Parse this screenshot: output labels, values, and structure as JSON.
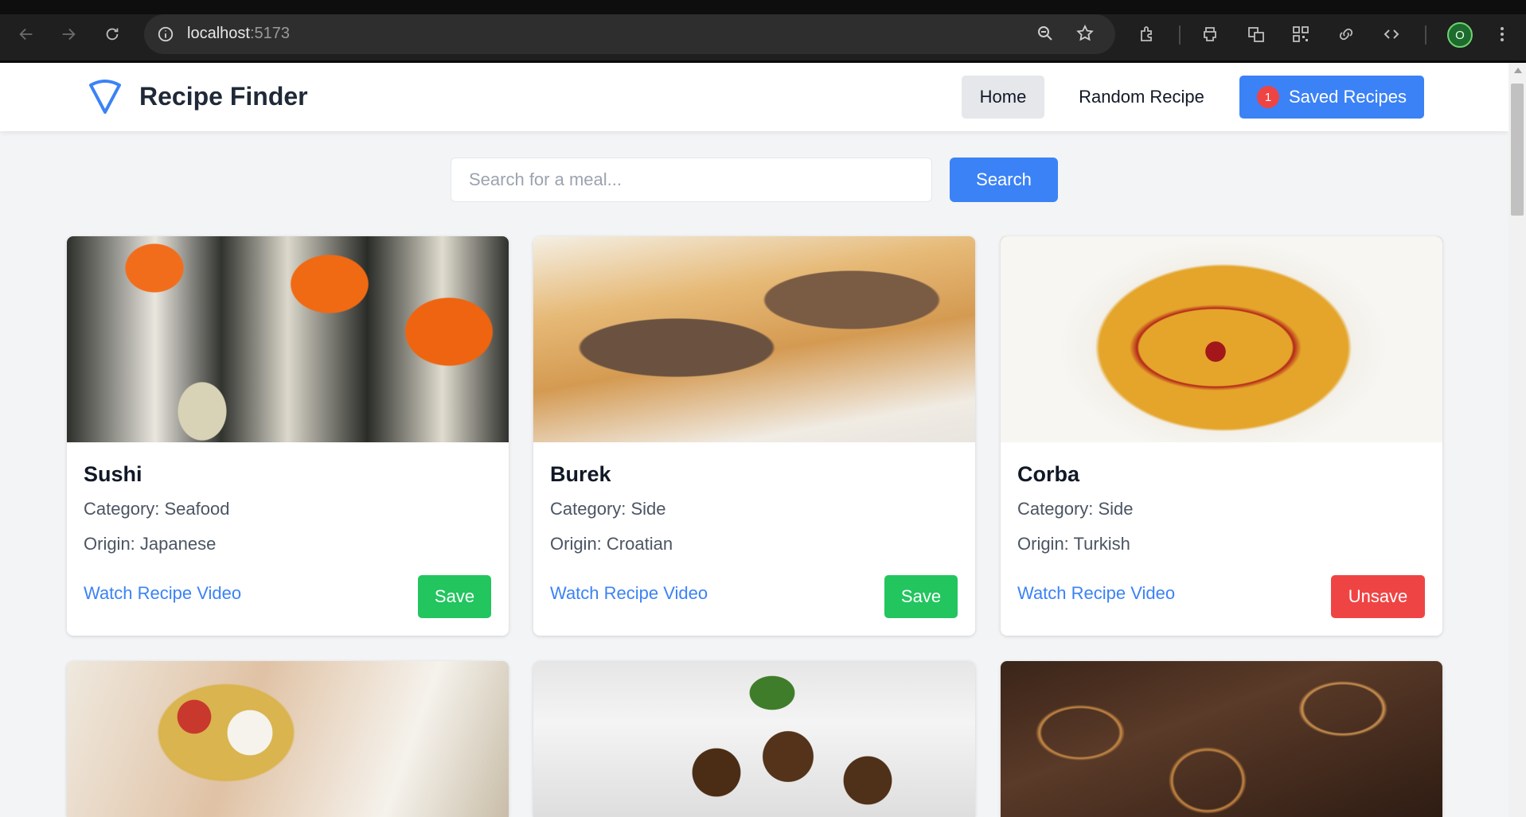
{
  "browser": {
    "url_host": "localhost",
    "url_port": ":5173",
    "profile_initial": "O"
  },
  "header": {
    "brand": "Recipe Finder",
    "nav": {
      "home": "Home",
      "random": "Random Recipe",
      "saved": "Saved Recipes",
      "saved_count": "1"
    }
  },
  "search": {
    "placeholder": "Search for a meal...",
    "button": "Search"
  },
  "recipes": [
    {
      "name": "Sushi",
      "category": "Category: Seafood",
      "origin": "Origin: Japanese",
      "video": "Watch Recipe Video",
      "action": "Save"
    },
    {
      "name": "Burek",
      "category": "Category: Side",
      "origin": "Origin: Croatian",
      "video": "Watch Recipe Video",
      "action": "Save"
    },
    {
      "name": "Corba",
      "category": "Category: Side",
      "origin": "Origin: Turkish",
      "video": "Watch Recipe Video",
      "action": "Unsave"
    }
  ],
  "colors": {
    "primary": "#3b82f6",
    "save": "#22c55e",
    "unsave": "#ef4444",
    "badge": "#ef4444"
  }
}
